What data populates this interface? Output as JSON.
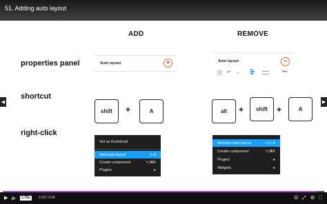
{
  "video": {
    "title": "51. Adding auto layout",
    "time": "3:18 / 3:24",
    "speed": "1.75x",
    "progress": 0.975
  },
  "columns": {
    "add": "ADD",
    "remove": "REMOVE"
  },
  "rows": {
    "properties": "properties panel",
    "shortcut": "shortcut",
    "rightclick": "right-click"
  },
  "add_panel": {
    "title": "Auto layout",
    "button": "+"
  },
  "remove_panel": {
    "title": "Auto layout",
    "button": "−",
    "more": "•••"
  },
  "add_keys": [
    "shift",
    "A"
  ],
  "remove_keys": [
    "alt",
    "shift",
    "A"
  ],
  "plus_sign": "+",
  "add_menu": {
    "items": [
      {
        "label": "Set as thumbnail",
        "shortcut": ""
      },
      {
        "label": "Add auto layout",
        "shortcut": "⇧ A"
      },
      {
        "label": "Create component",
        "shortcut": "⌥⌘K"
      },
      {
        "label": "Plugins",
        "shortcut": "▸"
      }
    ]
  },
  "remove_menu": {
    "items": [
      {
        "label": "Remove auto layout",
        "shortcut": "⌥⇧ A"
      },
      {
        "label": "Create component",
        "shortcut": "⌥⌘K"
      },
      {
        "label": "Plugins",
        "shortcut": "▸"
      },
      {
        "label": "Widgets",
        "shortcut": "▸"
      }
    ]
  },
  "colors": {
    "accent": "#e0621e",
    "highlight": "#18a0fb",
    "progress": "#a64cd9"
  }
}
